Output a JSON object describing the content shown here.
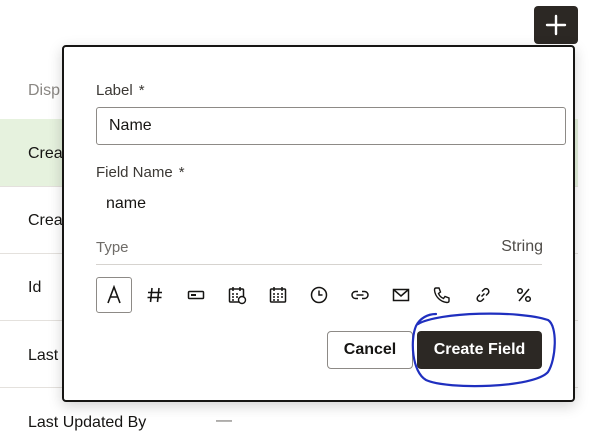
{
  "background": {
    "header": "Disp",
    "rows": [
      {
        "label": "Crea",
        "highlight": true
      },
      {
        "label": "Crea",
        "highlight": false
      },
      {
        "label": "Id",
        "highlight": false
      },
      {
        "label": "Last",
        "highlight": false
      },
      {
        "label": "Last Updated By",
        "value": "—",
        "highlight": false
      }
    ],
    "highlight_color": "#e6f2de",
    "add_icon": "plus-icon"
  },
  "dialog": {
    "label_title": "Label",
    "label_required": "*",
    "label_value": "Name",
    "field_name_title": "Field Name",
    "field_name_required": "*",
    "field_name_value": "name",
    "type_title": "Type",
    "type_value": "String",
    "type_icons": [
      {
        "name": "text-type-icon",
        "selected": true
      },
      {
        "name": "number-type-icon",
        "selected": false
      },
      {
        "name": "boolean-type-icon",
        "selected": false
      },
      {
        "name": "datetime-type-icon",
        "selected": false
      },
      {
        "name": "date-type-icon",
        "selected": false
      },
      {
        "name": "time-type-icon",
        "selected": false
      },
      {
        "name": "link-type-icon",
        "selected": false
      },
      {
        "name": "email-type-icon",
        "selected": false
      },
      {
        "name": "phone-type-icon",
        "selected": false
      },
      {
        "name": "url-type-icon",
        "selected": false
      },
      {
        "name": "percent-type-icon",
        "selected": false
      }
    ],
    "cancel_label": "Cancel",
    "create_label": "Create Field"
  },
  "colors": {
    "dark_button": "#2c2824",
    "annotation": "#1f2fbf"
  }
}
